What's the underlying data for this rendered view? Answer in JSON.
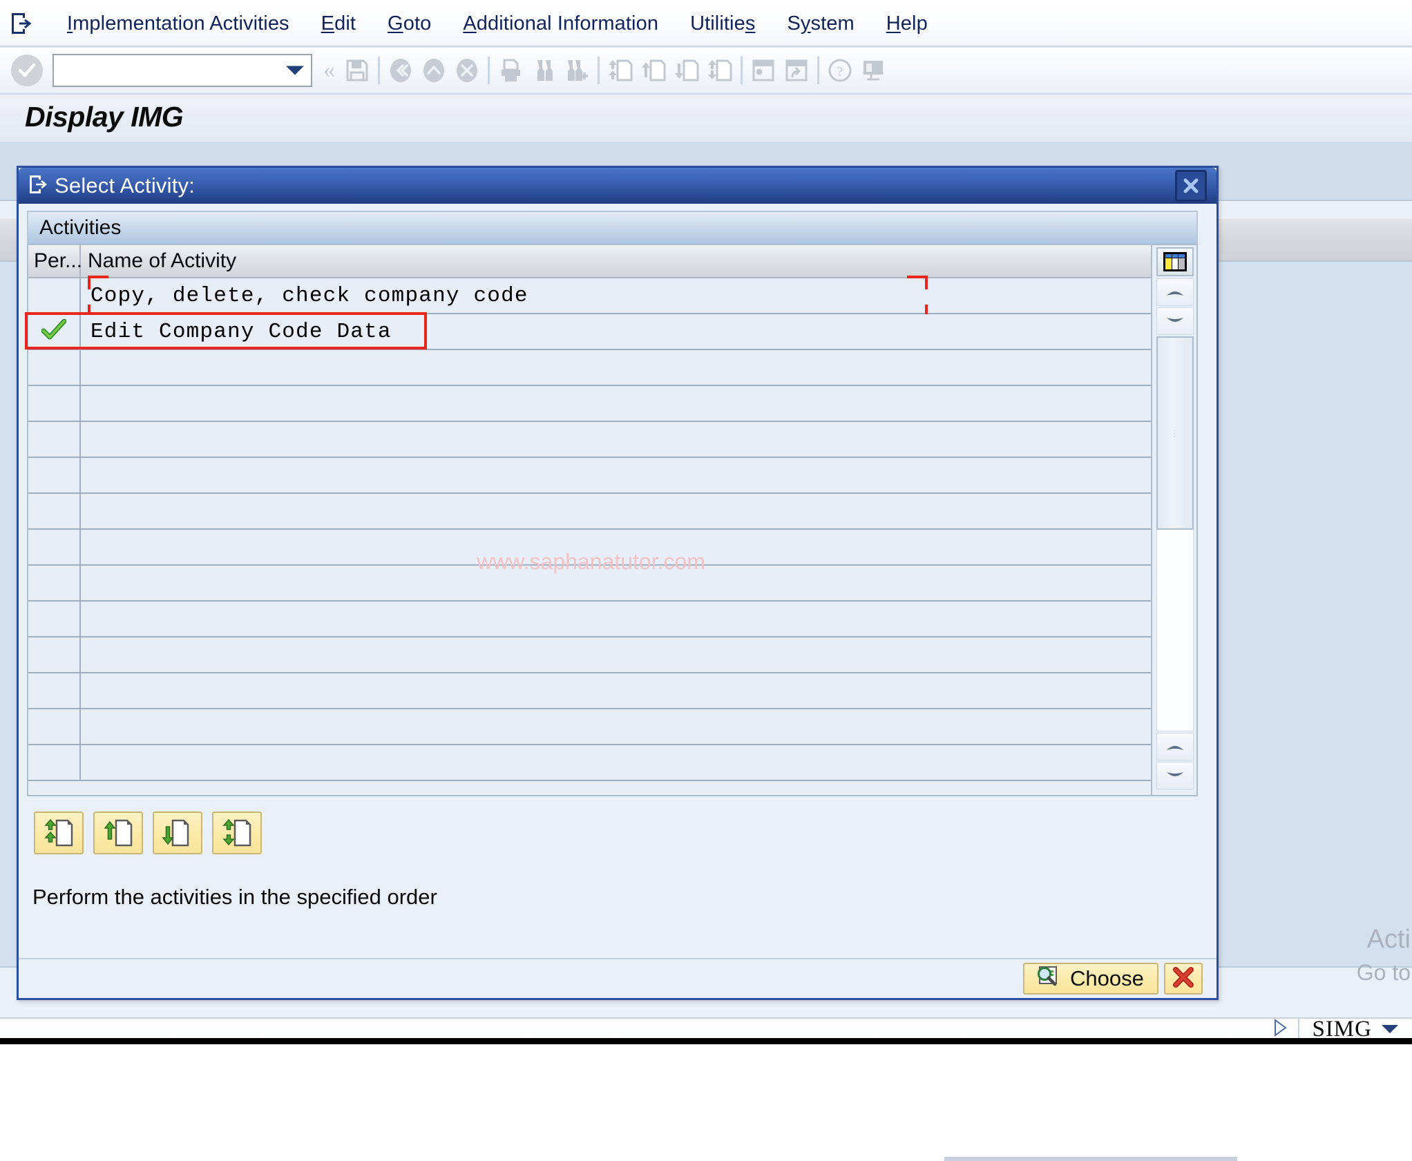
{
  "menu": {
    "system_icon": "sap-session-icon",
    "items": [
      {
        "label": "Implementation Activities",
        "accel": "I"
      },
      {
        "label": "Edit",
        "accel": "E"
      },
      {
        "label": "Goto",
        "accel": "G"
      },
      {
        "label": "Additional Information",
        "accel": "A"
      },
      {
        "label": "Utilities",
        "accel": "s"
      },
      {
        "label": "System",
        "accel": "y"
      },
      {
        "label": "Help",
        "accel": "H"
      }
    ]
  },
  "toolbar": {
    "ok_icon": "check-circle-icon",
    "command_field_value": "",
    "command_field_placeholder": "",
    "buttons": [
      {
        "icon": "save-icon"
      },
      {
        "icon": "back-icon"
      },
      {
        "icon": "exit-icon"
      },
      {
        "icon": "cancel-icon"
      },
      {
        "icon": "print-icon"
      },
      {
        "icon": "find-icon"
      },
      {
        "icon": "find-next-icon"
      },
      {
        "icon": "first-page-icon"
      },
      {
        "icon": "previous-page-icon"
      },
      {
        "icon": "next-page-icon"
      },
      {
        "icon": "last-page-icon"
      },
      {
        "icon": "create-session-icon"
      },
      {
        "icon": "create-shortcut-icon"
      },
      {
        "icon": "help-icon"
      },
      {
        "icon": "customize-layout-icon"
      }
    ]
  },
  "page": {
    "title": "Display IMG"
  },
  "background": {
    "right_text_line1": "Acti",
    "right_text_line2": "Go to"
  },
  "statusbar": {
    "play_icon": "play-triangle-icon",
    "transaction": "SIMG",
    "caret_icon": "chevron-down-icon"
  },
  "dialog": {
    "title": "Select Activity:",
    "title_icon": "sap-session-icon",
    "close_icon": "close-icon",
    "groupbox_label": "Activities",
    "table": {
      "columns": [
        {
          "key": "performed",
          "label": "Per..."
        },
        {
          "key": "name",
          "label": "Name of Activity"
        }
      ],
      "rows": [
        {
          "performed": "",
          "status_icon": "",
          "name": "Copy, delete, check company code",
          "annotated": true,
          "annotation_style": "corner-brackets"
        },
        {
          "performed": "done",
          "status_icon": "green-check-icon",
          "name": "Edit Company Code Data",
          "annotated": true,
          "annotation_style": "full-box"
        },
        {
          "performed": "",
          "status_icon": "",
          "name": ""
        },
        {
          "performed": "",
          "status_icon": "",
          "name": ""
        },
        {
          "performed": "",
          "status_icon": "",
          "name": ""
        },
        {
          "performed": "",
          "status_icon": "",
          "name": ""
        },
        {
          "performed": "",
          "status_icon": "",
          "name": ""
        },
        {
          "performed": "",
          "status_icon": "",
          "name": ""
        },
        {
          "performed": "",
          "status_icon": "",
          "name": ""
        },
        {
          "performed": "",
          "status_icon": "",
          "name": ""
        },
        {
          "performed": "",
          "status_icon": "",
          "name": ""
        },
        {
          "performed": "",
          "status_icon": "",
          "name": ""
        },
        {
          "performed": "",
          "status_icon": "",
          "name": ""
        },
        {
          "performed": "",
          "status_icon": "",
          "name": ""
        }
      ]
    },
    "scrollbar": {
      "config_icon": "column-config-icon",
      "up_icon": "scroll-up-icon",
      "down_icon": "scroll-down-icon",
      "bottom_up_icon": "scroll-up-icon",
      "bottom_down_icon": "scroll-down-icon",
      "thumb_grip": "⋯"
    },
    "nav_buttons": [
      {
        "icon": "first-activity-icon",
        "name": "first"
      },
      {
        "icon": "previous-activity-icon",
        "name": "previous"
      },
      {
        "icon": "next-activity-icon",
        "name": "next"
      },
      {
        "icon": "last-activity-icon",
        "name": "last"
      }
    ],
    "hint": "Perform the activities in the specified order",
    "choose_label": "Choose",
    "choose_icon": "magnifier-icon",
    "cancel_icon": "red-x-icon"
  },
  "watermark": {
    "text": "www.saphanatutor.com",
    "color": "#f0c3c6"
  },
  "colors": {
    "dialog_border": "#2b4f9e",
    "title_bar": "#2c4d9a",
    "annotation_red": "#e8261b",
    "button_yellow": "#fbe9a6",
    "row_background": "#e8eef7",
    "grid_line": "#9fb0c4"
  }
}
